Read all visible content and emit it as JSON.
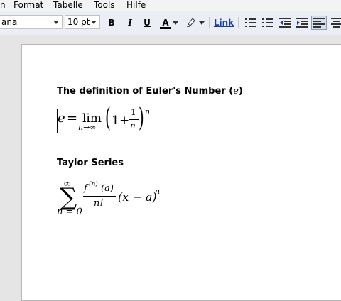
{
  "menu": {
    "items": [
      "n",
      "Format",
      "Tabelle",
      "Tools",
      "Hilfe"
    ]
  },
  "toolbar": {
    "font": "ana",
    "size": "10 pt",
    "bold": "B",
    "italic": "I",
    "underline": "U",
    "font_color": "A",
    "link": "Link"
  },
  "doc": {
    "heading1": "The definition of Euler's Number (",
    "heading1_e": "e",
    "heading1_end": ")",
    "euler": {
      "lhs": "e",
      "eq": "=",
      "lim": "lim",
      "sub": "n→∞",
      "one": "1",
      "plus": "+",
      "num": "1",
      "den": "n",
      "exp": "n"
    },
    "heading2": "Taylor Series",
    "taylor": {
      "top": "∞",
      "sigma": "∑",
      "bottom": "n = 0",
      "num": "f",
      "num_sup": "(n)",
      "num_arg": "(a)",
      "den": "n!",
      "term": "(x − a)",
      "exp": "n"
    }
  },
  "colors": {
    "toolbar_bg": "#ebeef4",
    "link": "#1a3ea8"
  }
}
